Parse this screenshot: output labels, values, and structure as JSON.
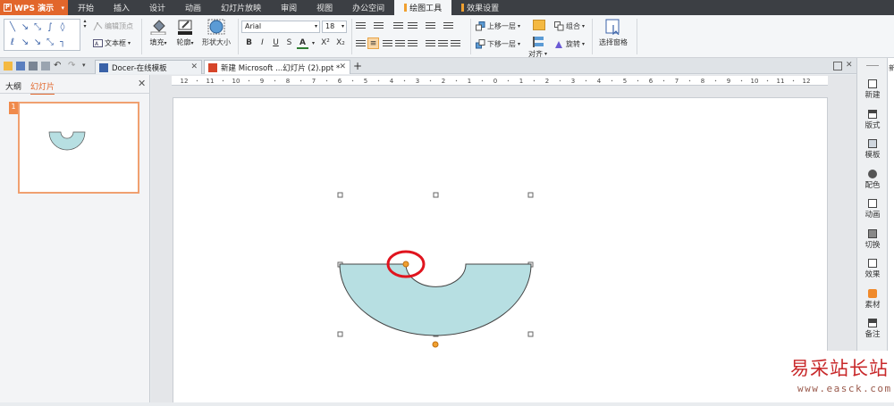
{
  "app": {
    "name": "WPS 演示",
    "logo": "P"
  },
  "menu_tabs": [
    {
      "label": "开始"
    },
    {
      "label": "插入"
    },
    {
      "label": "设计"
    },
    {
      "label": "动画"
    },
    {
      "label": "幻灯片放映"
    },
    {
      "label": "审阅"
    },
    {
      "label": "视图"
    },
    {
      "label": "办公空间"
    },
    {
      "label": "绘图工具",
      "active": true
    },
    {
      "label": "效果设置"
    }
  ],
  "ribbon": {
    "edit_vertex": "编辑顶点",
    "textbox": "文本框",
    "fill": "填充",
    "outline": "轮廓",
    "shape_size": "形状大小",
    "font_name": "Arial",
    "font_size": "18",
    "bring_forward": "上移一层",
    "send_backward": "下移一层",
    "group": "组合",
    "align": "对齐",
    "rotate": "旋转",
    "selection_pane": "选择窗格",
    "format_buttons": [
      "B",
      "I",
      "U",
      "S",
      "A",
      "X²",
      "X₂"
    ]
  },
  "doc_tabs": [
    {
      "label": "Docer-在线模板"
    },
    {
      "label": "新建 Microsoft ...幻灯片 (2).ppt *",
      "active": true
    }
  ],
  "left_panel": {
    "tab_outline": "大纲",
    "tab_slides": "幻灯片",
    "slide_number": "1"
  },
  "ruler": {
    "labels": [
      "12",
      "11",
      "10",
      "9",
      "8",
      "7",
      "6",
      "5",
      "4",
      "3",
      "2",
      "1",
      "0",
      "1",
      "2",
      "3",
      "4",
      "5",
      "6",
      "7",
      "8",
      "9",
      "10",
      "11",
      "12"
    ]
  },
  "right_panel": {
    "items": [
      {
        "label": "新建",
        "icon": "new-icon"
      },
      {
        "label": "版式",
        "icon": "layout-icon"
      },
      {
        "label": "模板",
        "icon": "template-icon"
      },
      {
        "label": "配色",
        "icon": "palette-icon"
      },
      {
        "label": "动画",
        "icon": "animation-icon"
      },
      {
        "label": "切换",
        "icon": "transition-icon"
      },
      {
        "label": "效果",
        "icon": "effect-icon"
      },
      {
        "label": "素材",
        "icon": "material-icon"
      },
      {
        "label": "备注",
        "icon": "notes-icon"
      }
    ],
    "edge_text": "新"
  },
  "colors": {
    "accent": "#e2662b",
    "menubar": "#3c3f44",
    "shape_fill": "#b7dfe2",
    "highlight_ring": "#e0141e",
    "handle_orange": "#f0a030"
  },
  "watermark": {
    "title": "易采站长站",
    "url": "www.easck.com"
  }
}
